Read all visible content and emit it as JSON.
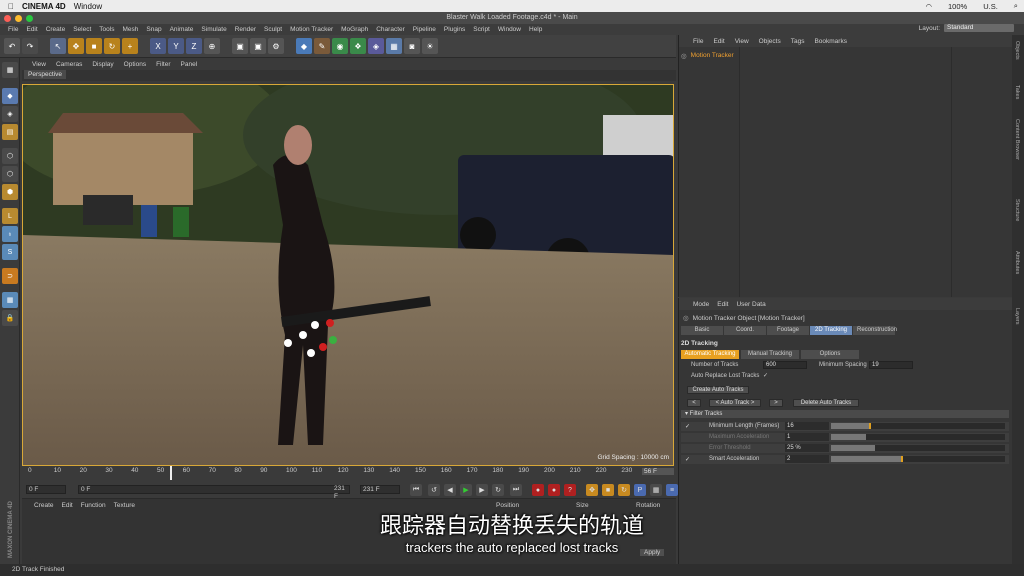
{
  "mac_menu": {
    "app": "CINEMA 4D",
    "window": "Window",
    "battery": "100%",
    "input": "U.S."
  },
  "window_title": "Blaster Walk Loaded Footage.c4d * - Main",
  "main_menu": [
    "File",
    "Edit",
    "Create",
    "Select",
    "Tools",
    "Mesh",
    "Snap",
    "Animate",
    "Simulate",
    "Render",
    "Sculpt",
    "Motion Tracker",
    "MoGraph",
    "Character",
    "Pipeline",
    "Plugins",
    "Script",
    "Window",
    "Help"
  ],
  "layout": {
    "label": "Layout:",
    "value": "Standard"
  },
  "viewport": {
    "menu": [
      "View",
      "Cameras",
      "Display",
      "Options",
      "Filter",
      "Panel"
    ],
    "tab": "Perspective",
    "grid_spacing": "Grid Spacing : 10000 cm"
  },
  "timeline": {
    "ticks": [
      "0",
      "10",
      "20",
      "30",
      "40",
      "50",
      "60",
      "70",
      "80",
      "90",
      "100",
      "110",
      "120",
      "130",
      "140",
      "150",
      "160",
      "170",
      "180",
      "190",
      "200",
      "210",
      "220",
      "230"
    ],
    "current_frame": "56 F",
    "start": "0 F",
    "range_start": "0 F",
    "range_end": "231 F",
    "end": "231 F"
  },
  "material_menu": [
    "Create",
    "Edit",
    "Function",
    "Texture"
  ],
  "coords": {
    "position": "Position",
    "size": "Size",
    "rotation": "Rotation",
    "apply": "Apply"
  },
  "status": "2D Track Finished",
  "objects": {
    "menu": [
      "File",
      "Edit",
      "View",
      "Objects",
      "Tags",
      "Bookmarks"
    ],
    "item": "Motion Tracker"
  },
  "attributes": {
    "menu": [
      "Mode",
      "Edit",
      "User Data"
    ],
    "object_title": "Motion Tracker Object [Motion Tracker]",
    "tabs": [
      "Basic",
      "Coord.",
      "Footage",
      "2D Tracking",
      "Reconstruction"
    ],
    "active_tab": "2D Tracking",
    "section": "2D Tracking",
    "subtabs": [
      "Automatic Tracking",
      "Manual Tracking",
      "Options"
    ],
    "number_of_tracks_label": "Number of Tracks",
    "number_of_tracks": "600",
    "minimum_spacing_label": "Minimum Spacing",
    "minimum_spacing": "19",
    "auto_replace_label": "Auto Replace Lost Tracks",
    "auto_replace_check": "✓",
    "create_auto_tracks": "Create Auto Tracks",
    "prev": "<",
    "auto_track": "< Auto Track >",
    "next": ">",
    "delete_auto_tracks": "Delete Auto Tracks",
    "filter_header": "▾ Filter Tracks",
    "filters": [
      {
        "label": "Minimum Length (Frames)",
        "value": "16",
        "enabled": true,
        "check": "✓",
        "level": 0.22
      },
      {
        "label": "Maximum Acceleration",
        "value": "1",
        "enabled": false,
        "check": "",
        "level": 0.2
      },
      {
        "label": "Error Threshold",
        "value": "25 %",
        "enabled": false,
        "check": "",
        "level": 0.25
      },
      {
        "label": "Smart Acceleration",
        "value": "2",
        "enabled": true,
        "check": "✓",
        "level": 0.4
      }
    ]
  },
  "right_strip": [
    "Objects",
    "Takes",
    "Content Browser",
    "Structure",
    "Attributes",
    "Layers"
  ],
  "subtitles": {
    "cn": "跟踪器自动替换丢失的轨道",
    "en": "trackers the auto replaced lost tracks"
  }
}
